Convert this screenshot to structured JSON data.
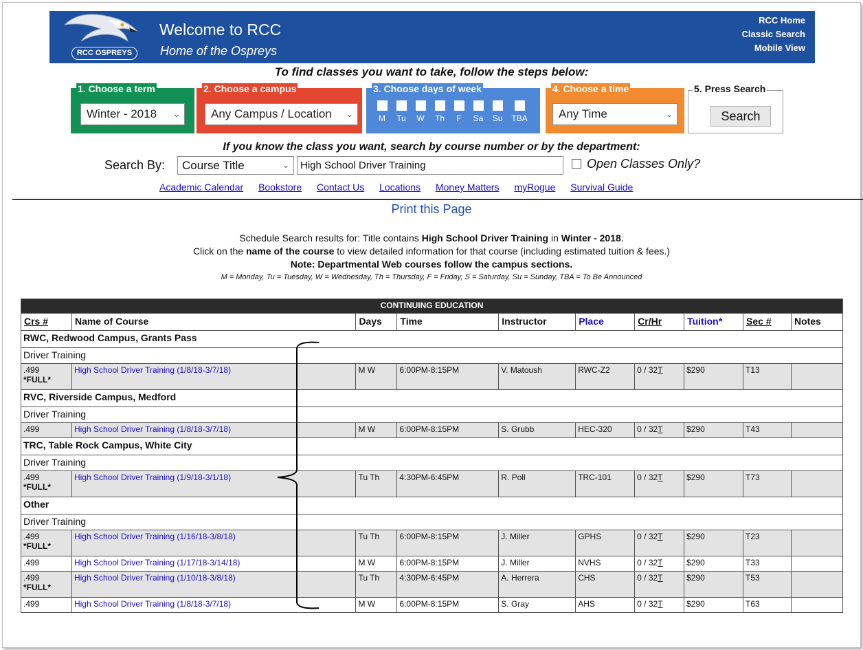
{
  "header": {
    "logo_text": "RCC OSPREYS",
    "welcome": "Welcome to RCC",
    "subtitle": "Home of the Ospreys",
    "links": [
      "RCC Home",
      "Classic Search",
      "Mobile View"
    ],
    "banner_color": "#1e50a0"
  },
  "steps": {
    "title": "To find classes you want to take, follow the steps below:",
    "term": {
      "legend": "1. Choose a term",
      "value": "Winter - 2018"
    },
    "campus": {
      "legend": "2. Choose a campus",
      "value": "Any Campus / Location"
    },
    "days": {
      "legend": "3. Choose days of week",
      "labels": [
        "M",
        "Tu",
        "W",
        "Th",
        "F",
        "Sa",
        "Su",
        "TBA"
      ]
    },
    "time": {
      "legend": "4. Choose a time",
      "value": "Any Time"
    },
    "search": {
      "legend": "5. Press Search",
      "button": "Search"
    },
    "colors": {
      "term": "#139154",
      "campus": "#e5462f",
      "days": "#4f87d9",
      "time": "#f28b30"
    }
  },
  "search_by": {
    "title": "If you know the class you want, search by course number or by the department:",
    "label": "Search By:",
    "field": "Course Title",
    "query": "High School Driver Training",
    "open_only": "Open Classes Only?"
  },
  "nav": [
    "Academic Calendar",
    "Bookstore",
    "Contact Us",
    "Locations",
    "Money Matters",
    "myRogue",
    "Survival Guide"
  ],
  "print": "Print this Page",
  "results": {
    "l1_a": "Schedule Search results for: Title contains ",
    "l1_b": "High School Driver Training",
    "l1_c": " in ",
    "l1_d": "Winter - 2018",
    "l1_e": ".",
    "l2_a": "Click on the ",
    "l2_b": "name of the course",
    "l2_c": " to view detailed information for that course (including estimated tuition & fees.)",
    "note": "Note: Departmental Web courses follow the campus sections.",
    "legend": "M = Monday, Tu = Tuesday, W = Wednesday, Th = Thursday, F = Friday, S = Saturday, Su = Sunday, TBA = To Be Announced"
  },
  "table": {
    "caption": "CONTINUING EDUCATION",
    "headers": [
      "Crs #",
      "Name of Course",
      "Days",
      "Time",
      "Instructor",
      "Place",
      "Cr/Hr",
      "Tuition*",
      "Sec #",
      "Notes"
    ],
    "groups": [
      {
        "campus": "RWC, Redwood Campus, Grants Pass",
        "dept": "Driver Training",
        "rows": [
          {
            "crs": ".499",
            "full": "*FULL*",
            "name": "High School Driver Training (1/8/18-3/7/18)",
            "days": "M W",
            "time": "6:00PM-8:15PM",
            "instructor": "V. Matoush",
            "place": "RWC-Z2",
            "cr_a": "0 / 32",
            "cr_b": "T",
            "tuition": "$290",
            "sec": "T13",
            "notes": ""
          }
        ]
      },
      {
        "campus": "RVC, Riverside Campus, Medford",
        "dept": "Driver Training",
        "rows": [
          {
            "crs": ".499",
            "full": "",
            "name": "High School Driver Training (1/8/18-3/7/18)",
            "days": "M W",
            "time": "6:00PM-8:15PM",
            "instructor": "S. Grubb",
            "place": "HEC-320",
            "cr_a": "0 / 32",
            "cr_b": "T",
            "tuition": "$290",
            "sec": "T43",
            "notes": ""
          }
        ]
      },
      {
        "campus": "TRC, Table Rock Campus, White City",
        "dept": "Driver Training",
        "rows": [
          {
            "crs": ".499",
            "full": "*FULL*",
            "name": "High School Driver Training (1/9/18-3/1/18)",
            "days": "Tu Th",
            "time": "4:30PM-6:45PM",
            "instructor": "R. Poll",
            "place": "TRC-101",
            "cr_a": "0 / 32",
            "cr_b": "T",
            "tuition": "$290",
            "sec": "T73",
            "notes": ""
          }
        ]
      },
      {
        "campus": "Other",
        "dept": "Driver Training",
        "rows": [
          {
            "crs": ".499",
            "full": "*FULL*",
            "name": "High School Driver Training (1/16/18-3/8/18)",
            "days": "Tu Th",
            "time": "6:00PM-8:15PM",
            "instructor": "J. Miller",
            "place": "GPHS",
            "cr_a": "0 / 32",
            "cr_b": "T",
            "tuition": "$290",
            "sec": "T23",
            "notes": ""
          },
          {
            "crs": ".499",
            "full": "",
            "name": "High School Driver Training (1/17/18-3/14/18)",
            "days": "M W",
            "time": "6:00PM-8:15PM",
            "instructor": "J. Miller",
            "place": "NVHS",
            "cr_a": "0 / 32",
            "cr_b": "T",
            "tuition": "$290",
            "sec": "T33",
            "notes": ""
          },
          {
            "crs": ".499",
            "full": "*FULL*",
            "name": "High School Driver Training (1/10/18-3/8/18)",
            "days": "Tu Th",
            "time": "4:30PM-6:45PM",
            "instructor": "A. Herrera",
            "place": "CHS",
            "cr_a": "0 / 32",
            "cr_b": "T",
            "tuition": "$290",
            "sec": "T53",
            "notes": ""
          },
          {
            "crs": ".499",
            "full": "",
            "name": "High School Driver Training (1/8/18-3/7/18)",
            "days": "M W",
            "time": "6:00PM-8:15PM",
            "instructor": "S. Gray",
            "place": "AHS",
            "cr_a": "0 / 32",
            "cr_b": "T",
            "tuition": "$290",
            "sec": "T63",
            "notes": ""
          }
        ]
      }
    ]
  }
}
